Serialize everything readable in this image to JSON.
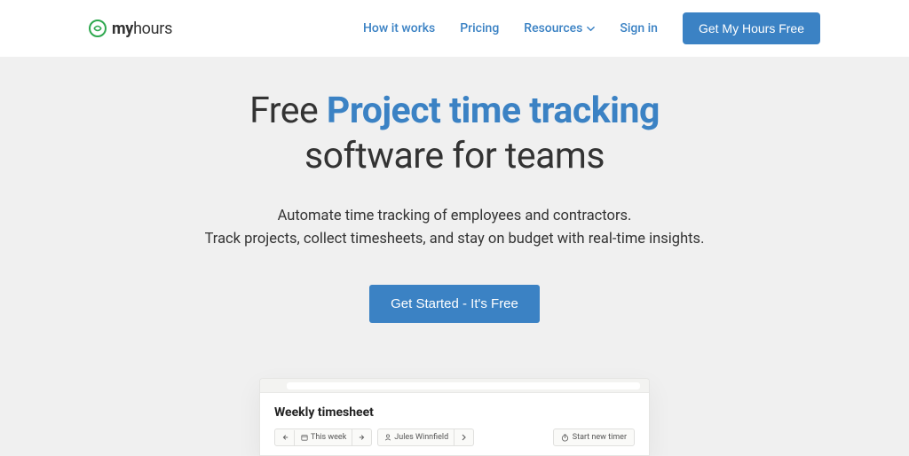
{
  "logo": {
    "prefix": "my",
    "suffix": "hours"
  },
  "nav": {
    "how_it_works": "How it works",
    "pricing": "Pricing",
    "resources": "Resources",
    "sign_in": "Sign in",
    "cta": "Get My Hours Free"
  },
  "hero": {
    "title_pre": "Free ",
    "title_highlight": "Project time tracking",
    "title_post": "software for teams",
    "sub_line1": "Automate time tracking of employees and contractors.",
    "sub_line2": "Track projects, collect timesheets, and stay on budget with real-time insights.",
    "cta": "Get Started - It's Free"
  },
  "preview": {
    "heading": "Weekly timesheet",
    "week_label": "This week",
    "user": "Jules Winnfield",
    "start_timer": "Start new timer"
  }
}
